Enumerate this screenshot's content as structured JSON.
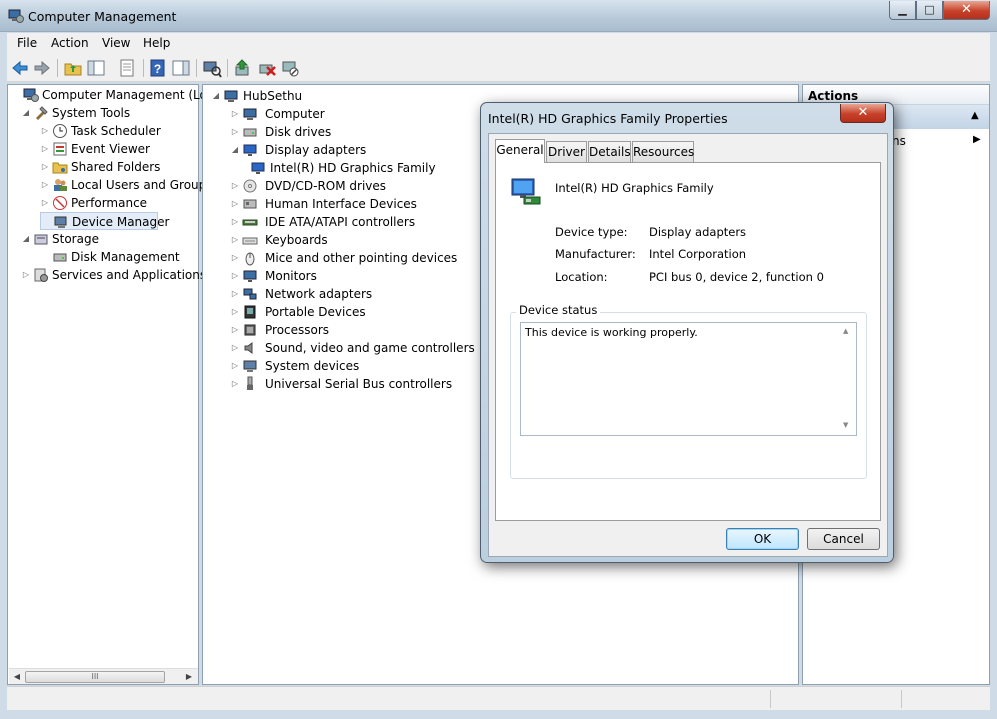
{
  "window": {
    "title": "Computer Management",
    "controls": {
      "minimize": "▁",
      "maximize": "□",
      "close": "✕"
    }
  },
  "menu": [
    "File",
    "Action",
    "View",
    "Help"
  ],
  "toolbar_icons": [
    "back-arrow-icon",
    "forward-arrow-icon",
    "up-folder-icon",
    "show-hide-tree-icon",
    "properties-icon",
    "help-icon",
    "show-action-pane-icon",
    "scan-hardware-icon",
    "update-driver-icon",
    "uninstall-icon",
    "disable-device-icon"
  ],
  "left_tree": [
    {
      "label": "Computer Management (Local",
      "depth": 0,
      "expander": ""
    },
    {
      "label": "System Tools",
      "depth": 1,
      "expander": "◢"
    },
    {
      "label": "Task Scheduler",
      "depth": 2,
      "expander": "▷"
    },
    {
      "label": "Event Viewer",
      "depth": 2,
      "expander": "▷"
    },
    {
      "label": "Shared Folders",
      "depth": 2,
      "expander": "▷"
    },
    {
      "label": "Local Users and Groups",
      "depth": 2,
      "expander": "▷"
    },
    {
      "label": "Performance",
      "depth": 2,
      "expander": "▷"
    },
    {
      "label": "Device Manager",
      "depth": 2,
      "expander": "",
      "selected": true
    },
    {
      "label": "Storage",
      "depth": 1,
      "expander": "◢"
    },
    {
      "label": "Disk Management",
      "depth": 2,
      "expander": ""
    },
    {
      "label": "Services and Applications",
      "depth": 1,
      "expander": "▷"
    }
  ],
  "hscroll": {
    "left": "◀",
    "thumb": "III",
    "right": "▶"
  },
  "device_tree": {
    "root": "HubSethu",
    "categories": [
      {
        "label": "Computer",
        "expander": "▷"
      },
      {
        "label": "Disk drives",
        "expander": "▷"
      },
      {
        "label": "Display adapters",
        "expander": "◢"
      },
      {
        "label": "Intel(R) HD Graphics Family",
        "expander": "",
        "child": true
      },
      {
        "label": "DVD/CD-ROM drives",
        "expander": "▷"
      },
      {
        "label": "Human Interface Devices",
        "expander": "▷"
      },
      {
        "label": "IDE ATA/ATAPI controllers",
        "expander": "▷"
      },
      {
        "label": "Keyboards",
        "expander": "▷"
      },
      {
        "label": "Mice and other pointing devices",
        "expander": "▷"
      },
      {
        "label": "Monitors",
        "expander": "▷"
      },
      {
        "label": "Network adapters",
        "expander": "▷"
      },
      {
        "label": "Portable Devices",
        "expander": "▷"
      },
      {
        "label": "Processors",
        "expander": "▷"
      },
      {
        "label": "Sound, video and game controllers",
        "expander": "▷"
      },
      {
        "label": "System devices",
        "expander": "▷"
      },
      {
        "label": "Universal Serial Bus controllers",
        "expander": "▷"
      }
    ]
  },
  "actions": {
    "header": "Actions",
    "row1_arrow": "▲",
    "row2_text": "ns",
    "row2_arrow": "▶"
  },
  "dialog": {
    "title": "Intel(R) HD Graphics Family Properties",
    "close": "✕",
    "tabs": [
      "General",
      "Driver",
      "Details",
      "Resources"
    ],
    "active_tab": "General",
    "device_name": "Intel(R) HD Graphics Family",
    "fields": [
      {
        "label": "Device type:",
        "value": "Display adapters"
      },
      {
        "label": "Manufacturer:",
        "value": "Intel Corporation"
      },
      {
        "label": "Location:",
        "value": "PCI bus 0, device 2, function 0"
      }
    ],
    "status_group": "Device status",
    "status_text": "This device is working properly.",
    "status_scroll": {
      "up": "▲",
      "down": "▼"
    },
    "ok": "OK",
    "cancel": "Cancel"
  },
  "colors": {
    "title_gradient_top": "#d7e3ee",
    "close_red": "#c7412a",
    "selection": "#e3ecf7",
    "ok_button": "#bee6fd"
  }
}
